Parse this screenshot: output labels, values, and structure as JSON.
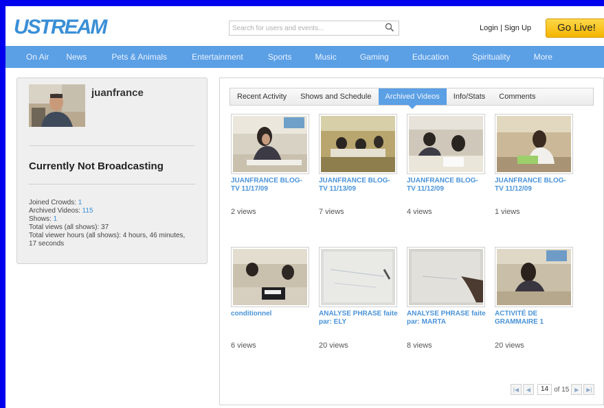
{
  "header": {
    "logo": "USTREAM",
    "search_placeholder": "Search for users and events...",
    "login": "Login",
    "separator": "|",
    "signup": "Sign Up",
    "go_live": "Go Live!"
  },
  "nav": {
    "items": [
      "On Air",
      "News",
      "Pets & Animals",
      "Entertainment",
      "Sports",
      "Music",
      "Gaming",
      "Education",
      "Spirituality",
      "More"
    ]
  },
  "profile": {
    "username": "juanfrance",
    "status": "Currently Not Broadcasting",
    "stats": {
      "joined_crowds_label": "Joined Crowds:",
      "joined_crowds": "1",
      "archived_videos_label": "Archived Videos:",
      "archived_videos": "115",
      "shows_label": "Shows:",
      "shows": "1",
      "total_views": "Total views (all shows): 37",
      "total_hours": "Total viewer hours (all shows): 4 hours, 46 minutes, 17 seconds"
    }
  },
  "tabs": [
    "Recent Activity",
    "Shows and Schedule",
    "Archived Videos",
    "Info/Stats",
    "Comments"
  ],
  "active_tab": "Archived Videos",
  "videos": [
    {
      "title": "JUANFRANCE BLOG-TV 11/17/09",
      "views": "2 views"
    },
    {
      "title": "JUANFRANCE BLOG-TV 11/13/09",
      "views": "7 views"
    },
    {
      "title": "JUANFRANCE BLOG-TV 11/12/09",
      "views": "4 views"
    },
    {
      "title": "JUANFRANCE BLOG-TV 11/12/09",
      "views": "1 views"
    },
    {
      "title": "conditionnel",
      "views": "6 views"
    },
    {
      "title": "ANALYSE PHRASE faite par: ELY",
      "views": "20 views"
    },
    {
      "title": "ANALYSE PHRASE faite par: MARTA",
      "views": "8 views"
    },
    {
      "title": "ACTIVITÉ DE GRAMMAIRE 1",
      "views": "20 views"
    }
  ],
  "pagination": {
    "current": "14",
    "of_label": "of 15"
  },
  "colors": {
    "brand_blue": "#3a8fd6",
    "nav_blue": "#5b9fe5",
    "go_live_yellow": "#f4b400",
    "link_blue": "#4a93d8"
  },
  "icons": [
    "search-icon",
    "first-page-icon",
    "prev-page-icon",
    "next-page-icon",
    "last-page-icon"
  ]
}
